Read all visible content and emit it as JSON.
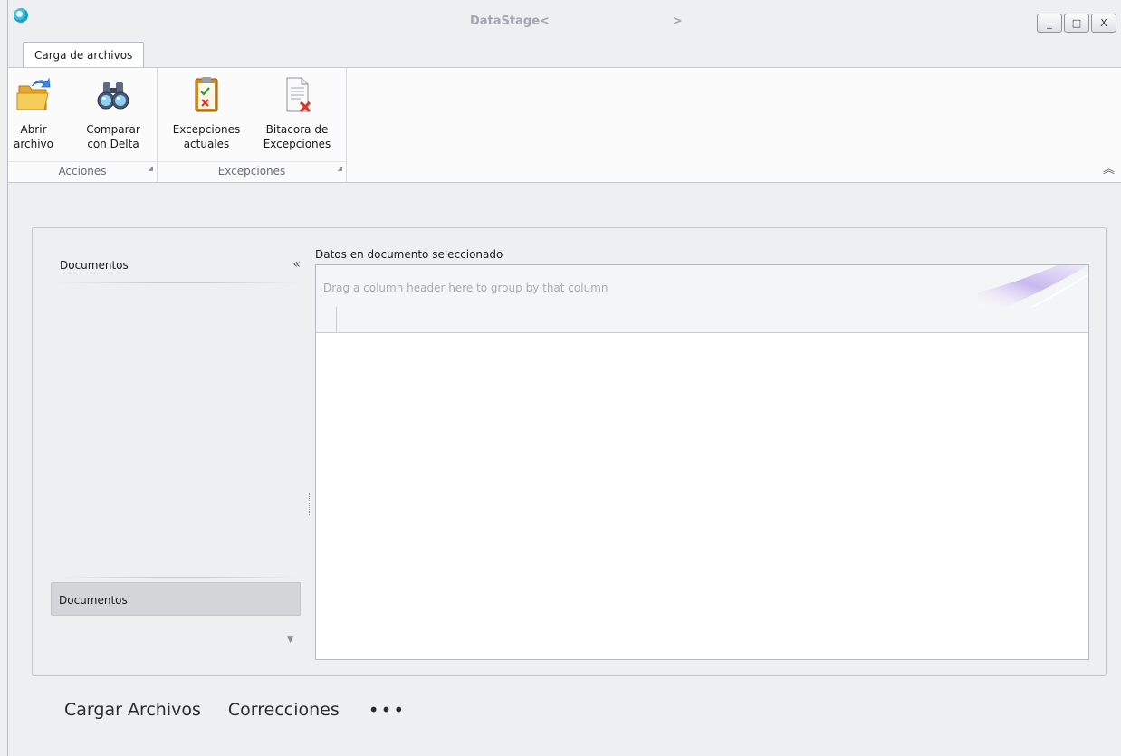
{
  "window": {
    "title": "DataStage<                              >",
    "controls": {
      "minimize": "_",
      "maximize": "□",
      "close": "X"
    }
  },
  "ribbon": {
    "tab": "Carga de archivos",
    "groups": [
      {
        "label": "Acciones",
        "buttons": [
          {
            "label_line1": "Abrir",
            "label_line2": "archivo",
            "icon": "open-folder-icon"
          },
          {
            "label_line1": "Comparar",
            "label_line2": "con Delta",
            "icon": "binoculars-icon"
          }
        ]
      },
      {
        "label": "Excepciones",
        "buttons": [
          {
            "label_line1": "Excepciones",
            "label_line2": "actuales",
            "icon": "clipboard-check-icon"
          },
          {
            "label_line1": "Bitacora de",
            "label_line2": "Excepciones",
            "icon": "document-delete-icon"
          }
        ]
      }
    ],
    "collapse_glyph": "︽"
  },
  "nav_pane": {
    "header": "Documentos",
    "collapse_glyph": "«",
    "group_button": "Documentos",
    "overflow_glyph": "▼"
  },
  "grid": {
    "caption": "Datos en documento seleccionado",
    "group_panel_text": "Drag a column header here to group by that column"
  },
  "bottom_nav": {
    "items": [
      "Cargar Archivos",
      "Correcciones"
    ],
    "more": "•••"
  }
}
